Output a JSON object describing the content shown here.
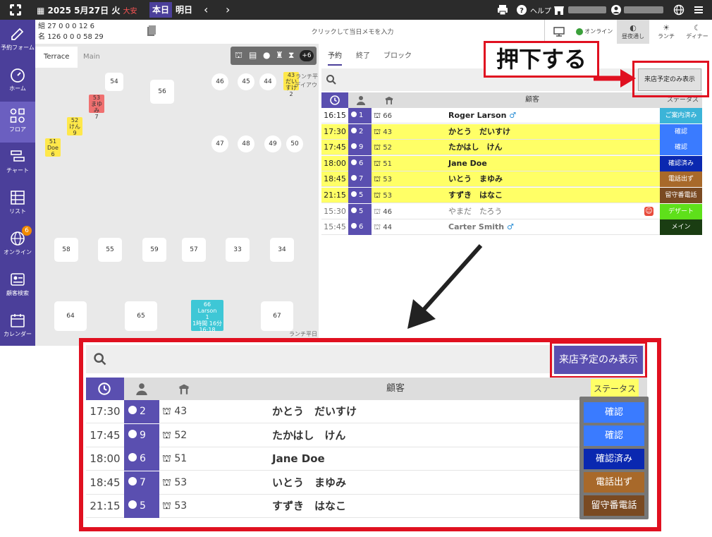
{
  "topbar": {
    "date": "2025 5月27日 火",
    "rokuyo": "大安",
    "today": "本日",
    "tomorrow": "明日",
    "help": "ヘルプ"
  },
  "sidebar": {
    "items": [
      {
        "label": "予約フォーム",
        "icon": "edit-icon"
      },
      {
        "label": "ホーム",
        "icon": "gauge-icon"
      },
      {
        "label": "フロア",
        "icon": "floor-icon"
      },
      {
        "label": "チャート",
        "icon": "chart-icon"
      },
      {
        "label": "リスト",
        "icon": "list-icon"
      },
      {
        "label": "オンライン",
        "icon": "globe-icon",
        "badge": "6"
      },
      {
        "label": "顧客検索",
        "icon": "customer-card-icon"
      },
      {
        "label": "カレンダー",
        "icon": "calendar-icon"
      }
    ]
  },
  "stats": {
    "row1_label": "組",
    "row1": "27 0 0 0 12 6",
    "row2_label": "名",
    "row2": "126 0 0 0 58 29"
  },
  "memo_placeholder": "クリックして当日メモを入力",
  "view_tabs": [
    {
      "label": "オンライン"
    },
    {
      "label": "昼夜通し"
    },
    {
      "label": "ランチ"
    },
    {
      "label": "ディナー"
    }
  ],
  "floor": {
    "tabs": [
      "Terrace",
      "Main"
    ],
    "tools_badge": "+6",
    "tables": [
      "54",
      "56",
      "46",
      "45",
      "44",
      "43",
      "53",
      "52",
      "51",
      "47",
      "48",
      "49",
      "50",
      "58",
      "55",
      "59",
      "57",
      "33",
      "34",
      "64",
      "65",
      "66",
      "67"
    ],
    "area_labels": [
      "ランチ平日",
      "デイアウト",
      "ランチ平日"
    ],
    "tiles": {
      "t53": {
        "name": "まゆみ",
        "count": "7"
      },
      "t52": {
        "name": "けん",
        "count": "9"
      },
      "t51": {
        "name": "Doe",
        "count": "6"
      },
      "t43": {
        "name": "だいすけ",
        "count": "2"
      },
      "t66": {
        "name": "Larson",
        "count": "1",
        "dur": "1時間 16分",
        "time": "16:18"
      }
    }
  },
  "right_tabs": [
    "予約",
    "終了",
    "ブロック"
  ],
  "filter_button": "来店予定のみ表示",
  "table_headers": {
    "customer": "顧客",
    "status": "ステータス"
  },
  "reservations": [
    {
      "time": "16:15",
      "people": "1",
      "table": "66",
      "name": "Roger Larson",
      "gender": "♂",
      "status": "ご案内済み",
      "status_color": "#3bb4d8",
      "row_color": "#ffffff",
      "muted": false
    },
    {
      "time": "17:30",
      "people": "2",
      "table": "43",
      "name": "かとう　だいすけ",
      "gender": "",
      "status": "確認",
      "status_color": "#3a7bff",
      "row_color": "#ffff66",
      "muted": false
    },
    {
      "time": "17:45",
      "people": "9",
      "table": "52",
      "name": "たかはし　けん",
      "gender": "",
      "status": "確認",
      "status_color": "#3a7bff",
      "row_color": "#ffff66",
      "muted": false
    },
    {
      "time": "18:00",
      "people": "6",
      "table": "51",
      "name": "Jane Doe",
      "gender": "",
      "status": "確認済み",
      "status_color": "#0a28b0",
      "row_color": "#ffff66",
      "muted": false
    },
    {
      "time": "18:45",
      "people": "7",
      "table": "53",
      "name": "いとう　まゆみ",
      "gender": "",
      "status": "電話出ず",
      "status_color": "#a8692a",
      "row_color": "#ffff66",
      "muted": false
    },
    {
      "time": "21:15",
      "people": "5",
      "table": "53",
      "name": "すずき　はなこ",
      "gender": "",
      "status": "留守番電話",
      "status_color": "#7a4a22",
      "row_color": "#ffff66",
      "muted": false
    },
    {
      "time": "15:30",
      "people": "5",
      "table": "46",
      "name": "やまだ　たろう",
      "gender": "",
      "status": "デザート",
      "status_color": "#5ee01a",
      "row_color": "#ffffff",
      "muted": true
    },
    {
      "time": "15:45",
      "people": "6",
      "table": "44",
      "name": "Carter Smith",
      "gender": "♂",
      "status": "メイン",
      "status_color": "#1a3d12",
      "row_color": "#ffffff",
      "muted": true
    }
  ],
  "callout_text": "押下する",
  "zoom": {
    "rows": [
      {
        "time": "17:30",
        "people": "2",
        "table": "43",
        "name": "かとう　だいすけ",
        "status": "確認",
        "status_color": "#3a7bff"
      },
      {
        "time": "17:45",
        "people": "9",
        "table": "52",
        "name": "たかはし　けん",
        "status": "確認",
        "status_color": "#3a7bff"
      },
      {
        "time": "18:00",
        "people": "6",
        "table": "51",
        "name": "Jane Doe",
        "status": "確認済み",
        "status_color": "#0a28b0"
      },
      {
        "time": "18:45",
        "people": "7",
        "table": "53",
        "name": "いとう　まゆみ",
        "status": "電話出ず",
        "status_color": "#a8692a"
      },
      {
        "time": "21:15",
        "people": "5",
        "table": "53",
        "name": "すずき　はなこ",
        "status": "留守番電話",
        "status_color": "#7a4a22"
      }
    ]
  },
  "colors": {
    "accent": "#4b3f9a",
    "highlight": "#e01020"
  }
}
